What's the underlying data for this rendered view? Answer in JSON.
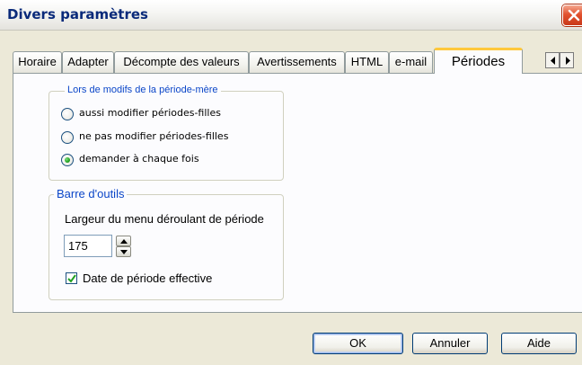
{
  "window": {
    "title": "Divers paramètres"
  },
  "tabs": [
    {
      "label": "Horaire",
      "active": false
    },
    {
      "label": "Adapter",
      "active": false
    },
    {
      "label": "Décompte des valeurs",
      "active": false
    },
    {
      "label": "Avertissements",
      "active": false
    },
    {
      "label": "HTML",
      "active": false
    },
    {
      "label": "e-mail",
      "active": false
    },
    {
      "label": "Périodes",
      "active": true
    }
  ],
  "period_group": {
    "title": "Lors de modifs de la période-mère",
    "options": [
      {
        "label": "aussi modifier périodes-filles",
        "selected": false
      },
      {
        "label": "ne pas modifier périodes-filles",
        "selected": false
      },
      {
        "label": "demander à chaque fois",
        "selected": true
      }
    ]
  },
  "toolbar_group": {
    "title": "Barre d'outils",
    "width_label": "Largeur du menu déroulant de période",
    "width_value": "175",
    "checkbox_label": "Date de période effective",
    "checkbox_checked": true
  },
  "buttons": {
    "ok": "OK",
    "cancel": "Annuler",
    "help": "Aide"
  },
  "colors": {
    "group_title": "#0b46c8",
    "active_tab_accent": "#ffc83c",
    "close_button": "#e2522f"
  }
}
